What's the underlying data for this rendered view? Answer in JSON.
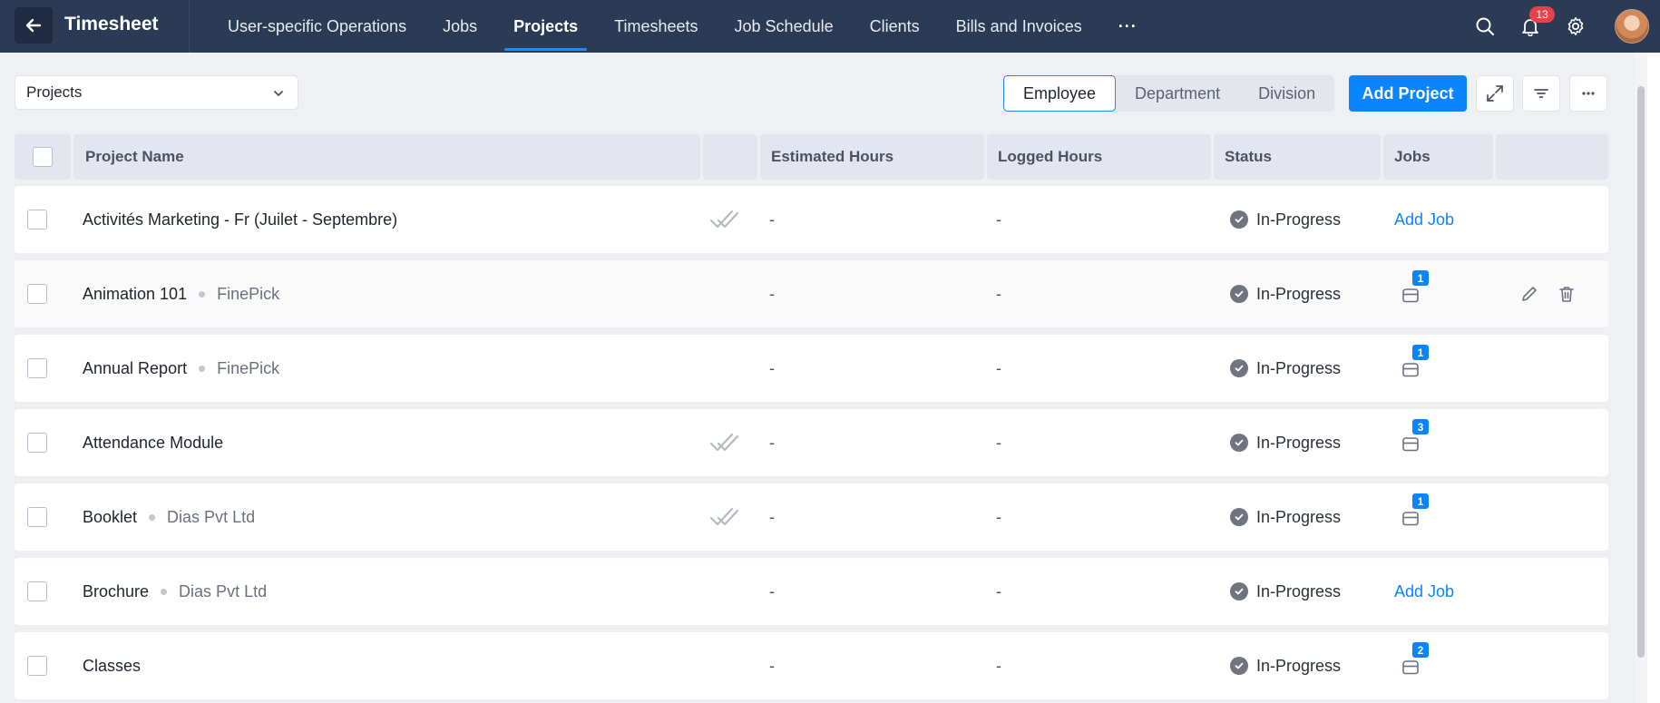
{
  "app": {
    "title": "Timesheet"
  },
  "nav": {
    "items": [
      {
        "label": "User-specific Operations"
      },
      {
        "label": "Jobs"
      },
      {
        "label": "Projects"
      },
      {
        "label": "Timesheets"
      },
      {
        "label": "Job Schedule"
      },
      {
        "label": "Clients"
      },
      {
        "label": "Bills and Invoices"
      }
    ],
    "active": "Projects",
    "more": "···",
    "notifications_count": "13"
  },
  "toolbar": {
    "view_select": "Projects",
    "segments": [
      "Employee",
      "Department",
      "Division"
    ],
    "active_segment": "Employee",
    "add_project_label": "Add Project"
  },
  "table": {
    "columns": [
      "Project Name",
      "",
      "Estimated Hours",
      "Logged Hours",
      "Status",
      "Jobs",
      ""
    ],
    "rows": [
      {
        "name": "Activités Marketing - Fr (Juilet - Septembre)",
        "client": "",
        "approved": true,
        "estimated": "-",
        "logged": "-",
        "status": "In-Progress",
        "jobs_label": "Add Job",
        "jobs_count": ""
      },
      {
        "name": "Animation 101",
        "client": "FinePick",
        "approved": false,
        "estimated": "-",
        "logged": "-",
        "status": "In-Progress",
        "jobs_label": "",
        "jobs_count": "1"
      },
      {
        "name": "Annual Report",
        "client": "FinePick",
        "approved": false,
        "estimated": "-",
        "logged": "-",
        "status": "In-Progress",
        "jobs_label": "",
        "jobs_count": "1"
      },
      {
        "name": "Attendance Module",
        "client": "",
        "approved": true,
        "estimated": "-",
        "logged": "-",
        "status": "In-Progress",
        "jobs_label": "",
        "jobs_count": "3"
      },
      {
        "name": "Booklet",
        "client": "Dias Pvt Ltd",
        "approved": true,
        "estimated": "-",
        "logged": "-",
        "status": "In-Progress",
        "jobs_label": "",
        "jobs_count": "1"
      },
      {
        "name": "Brochure",
        "client": "Dias Pvt Ltd",
        "approved": false,
        "estimated": "-",
        "logged": "-",
        "status": "In-Progress",
        "jobs_label": "Add Job",
        "jobs_count": ""
      },
      {
        "name": "Classes",
        "client": "",
        "approved": false,
        "estimated": "-",
        "logged": "-",
        "status": "In-Progress",
        "jobs_label": "",
        "jobs_count": "2"
      }
    ]
  },
  "colors": {
    "topbar": "#2b3a55",
    "accent": "#0a84ff",
    "badge": "#e8434a"
  }
}
